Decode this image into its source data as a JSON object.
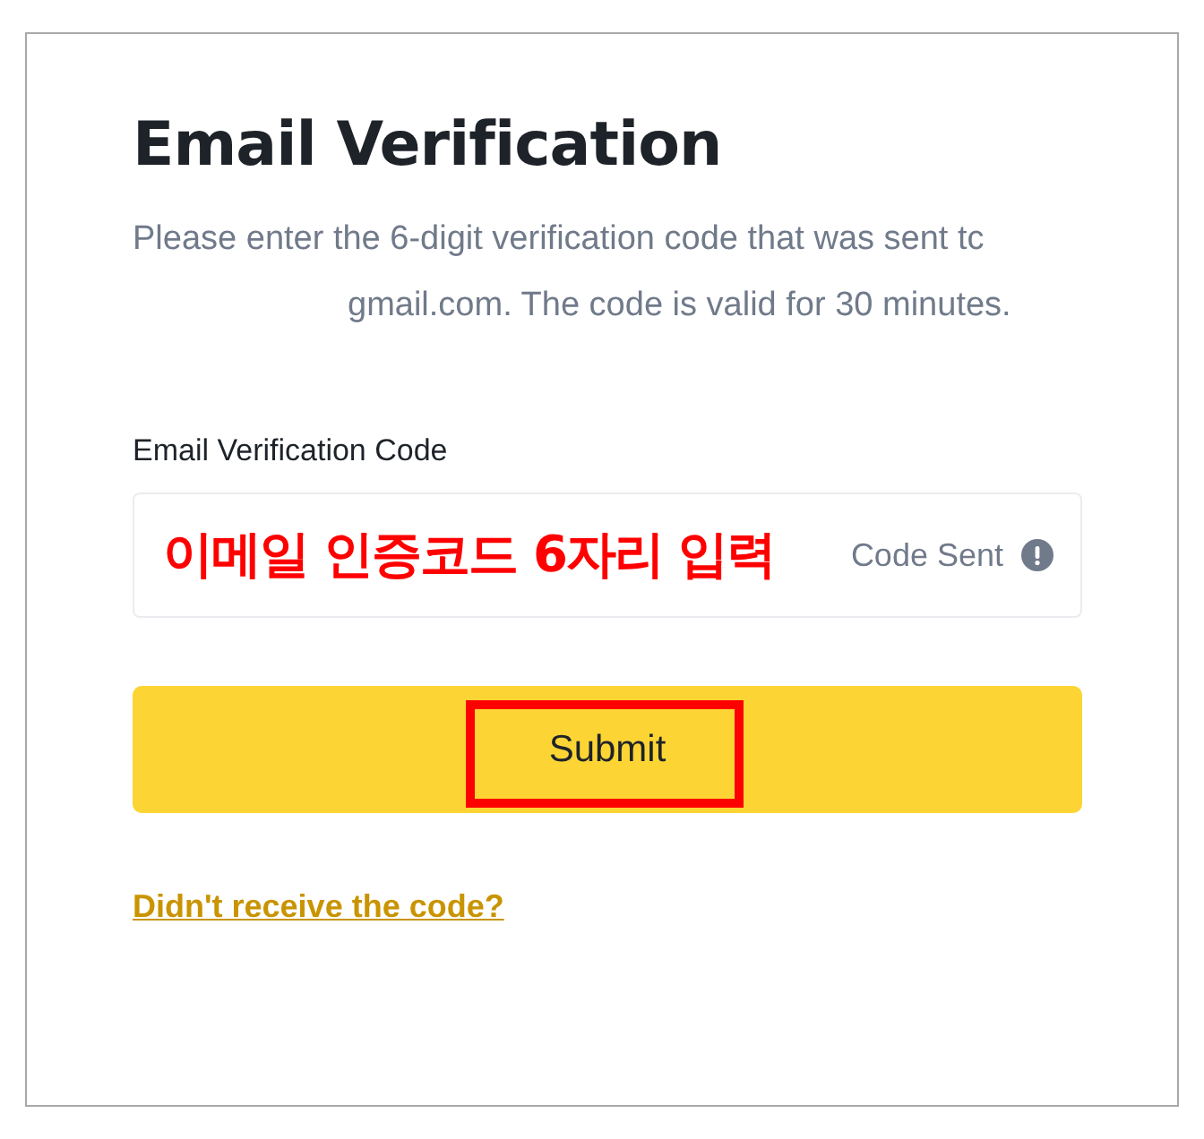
{
  "title": "Email Verification",
  "description": {
    "before": "Please enter the 6-digit verification code that was sent tc",
    "redacted": true,
    "after": "gmail.com. The code is valid for 30 minutes."
  },
  "field": {
    "label": "Email Verification Code",
    "annotation": "이메일 인증코드 6자리 입력",
    "status": "Code Sent"
  },
  "submit": {
    "label": "Submit",
    "highlighted": true
  },
  "link": "Didn't receive the code?"
}
